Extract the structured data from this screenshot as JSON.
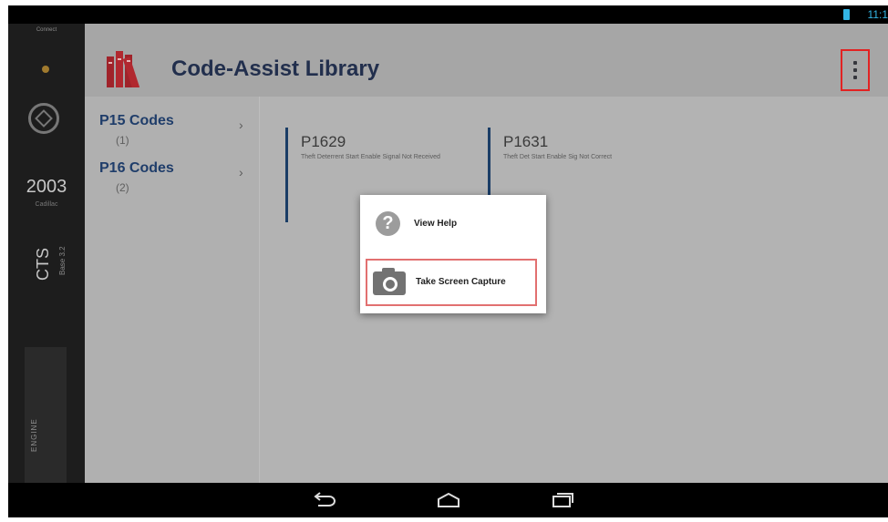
{
  "status_bar": {
    "time": "11:1"
  },
  "side_panel": {
    "connection_label": "Connect",
    "year": "2003",
    "make": "Cadillac",
    "model": "CTS",
    "engine_size": "Base 3.2",
    "tab_label": "ENGINE"
  },
  "action_bar": {
    "title": "Code-Assist Library"
  },
  "code_groups": [
    {
      "title": "P15 Codes",
      "count": "(1)"
    },
    {
      "title": "P16 Codes",
      "count": "(2)"
    }
  ],
  "codes": [
    {
      "code": "P1629",
      "description": "Theft Deterrent Start Enable Signal Not Received"
    },
    {
      "code": "P1631",
      "description": "Theft Det Start Enable Sig Not Correct"
    }
  ],
  "overflow_menu": {
    "view_help": "View Help",
    "take_screen_capture": "Take Screen Capture"
  },
  "colors": {
    "accent_blue": "#1a3d66",
    "highlight_red": "#e22222",
    "battery_blue": "#33b5e5"
  },
  "icons": [
    "battery-icon",
    "cadillac-logo-icon",
    "library-books-icon",
    "overflow-menu-icon",
    "chevron-right-icon",
    "help-icon",
    "camera-icon",
    "back-icon",
    "home-icon",
    "recent-apps-icon"
  ]
}
